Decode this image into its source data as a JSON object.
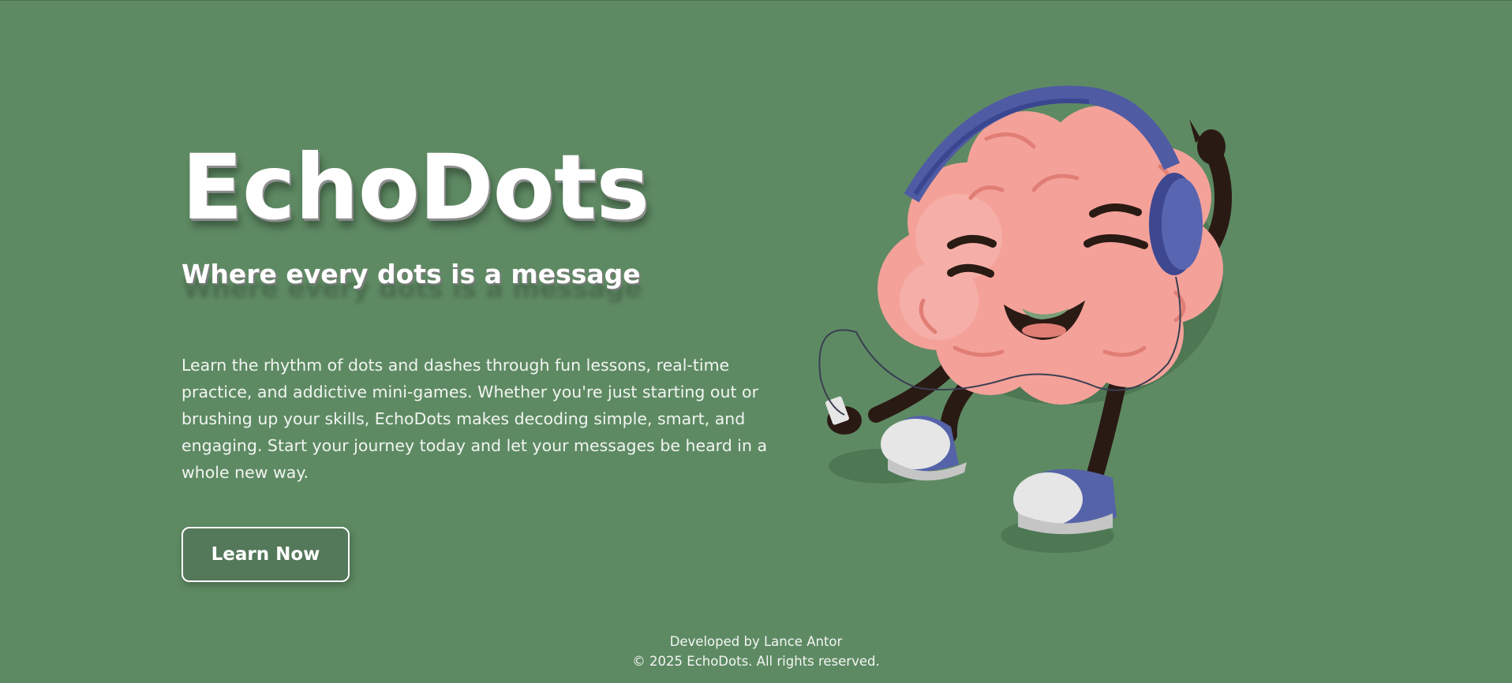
{
  "hero": {
    "title": "EchoDots",
    "subtitle": "Where every dots is a message",
    "description": "Learn the rhythm of dots and dashes through fun lessons, real-time practice, and addictive mini-games. Whether you're just starting out or brushing up your skills, EchoDots makes decoding simple, smart, and engaging. Start your journey today and let your messages be heard in a whole new way.",
    "cta_label": "Learn Now"
  },
  "illustration": {
    "icon": "brain-mascot-with-headphones"
  },
  "footer": {
    "developer": "Developed by Lance Antor",
    "copyright": "© 2025 EchoDots. All rights reserved."
  },
  "colors": {
    "background": "#5e8a63",
    "brain": "#f4a199",
    "headphones": "#4f5ba3"
  }
}
